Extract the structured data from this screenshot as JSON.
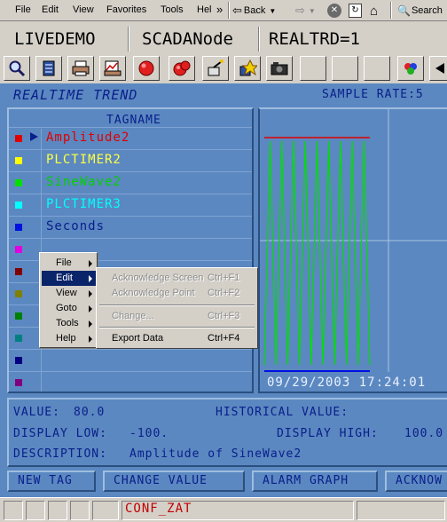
{
  "menubar": {
    "items": [
      "File",
      "Edit",
      "View",
      "Favorites",
      "Tools",
      "Hel"
    ],
    "chevron": "»",
    "back_label": "Back",
    "search_label": "Search"
  },
  "header": {
    "project": "LIVEDEMO",
    "node": "SCADANode",
    "screen": "REALTRD=1"
  },
  "toolbar": {
    "icons": [
      "magnifier-icon",
      "server-icon",
      "printer-icon",
      "chart-print-icon",
      "alarm-bell-icon",
      "alarm-bells-icon",
      "acknowledge-icon",
      "ack-all-icon",
      "camera-icon",
      "color-balls-icon",
      "back-arrow-icon"
    ]
  },
  "trend": {
    "title": "REALTIME TREND",
    "sample_rate": "SAMPLE RATE:5",
    "tag_header": "TAGNAME",
    "timestamp": "09/29/2003 17:24:01"
  },
  "tags": [
    {
      "name": "Amplitude2",
      "color": "#e00000",
      "text_color": "#e00000",
      "selected": true
    },
    {
      "name": "PLCTIMER2",
      "color": "#ffff00",
      "text_color": "#ffff40",
      "selected": false
    },
    {
      "name": "SineWave2",
      "color": "#00e000",
      "text_color": "#00d000",
      "selected": false
    },
    {
      "name": "PLCTIMER3",
      "color": "#00ffff",
      "text_color": "#00ffff",
      "selected": false
    },
    {
      "name": "Seconds",
      "color": "#0010e0",
      "text_color": "#0a1e8c",
      "selected": false
    },
    {
      "name": "",
      "color": "#e000e0",
      "text_color": "#000",
      "selected": false
    },
    {
      "name": "",
      "color": "#800000",
      "text_color": "#000",
      "selected": false
    },
    {
      "name": "",
      "color": "#808000",
      "text_color": "#000",
      "selected": false
    },
    {
      "name": "",
      "color": "#008000",
      "text_color": "#000",
      "selected": false
    },
    {
      "name": "",
      "color": "#008080",
      "text_color": "#000",
      "selected": false
    },
    {
      "name": "",
      "color": "#000080",
      "text_color": "#000",
      "selected": false
    },
    {
      "name": "",
      "color": "#800080",
      "text_color": "#000",
      "selected": false
    }
  ],
  "info": {
    "value_label": "VALUE:",
    "value": "80.0",
    "historical_label": "HISTORICAL VALUE:",
    "display_low_label": "DISPLAY LOW:",
    "display_low": "-100.",
    "display_high_label": "DISPLAY HIGH:",
    "display_high": "100.0",
    "description_label": "DESCRIPTION:",
    "description": "Amplitude of SineWave2"
  },
  "buttons": [
    "NEW TAG",
    "CHANGE VALUE",
    "ALARM GRAPH",
    "ACKNOW"
  ],
  "status": {
    "text": "CONF_ZAT"
  },
  "context_menu": {
    "items": [
      {
        "label": "File",
        "selected": false
      },
      {
        "label": "Edit",
        "selected": true
      },
      {
        "label": "View",
        "selected": false
      },
      {
        "label": "Goto",
        "selected": false
      },
      {
        "label": "Tools",
        "selected": false
      },
      {
        "label": "Help",
        "selected": false
      }
    ],
    "edit_submenu": [
      {
        "label": "Acknowledge Screen",
        "shortcut": "Ctrl+F1",
        "enabled": false
      },
      {
        "label": "Acknowledge Point",
        "shortcut": "Ctrl+F2",
        "enabled": false
      },
      {
        "label": "Change...",
        "shortcut": "Ctrl+F3",
        "enabled": false
      },
      {
        "label": "Export Data",
        "shortcut": "Ctrl+F4",
        "enabled": true
      }
    ]
  },
  "colors": {
    "panel_bg": "#5b88c0",
    "panel_text": "#0a1e8c",
    "trend_line_green": "#00e000",
    "trend_line_red": "#e00000"
  }
}
